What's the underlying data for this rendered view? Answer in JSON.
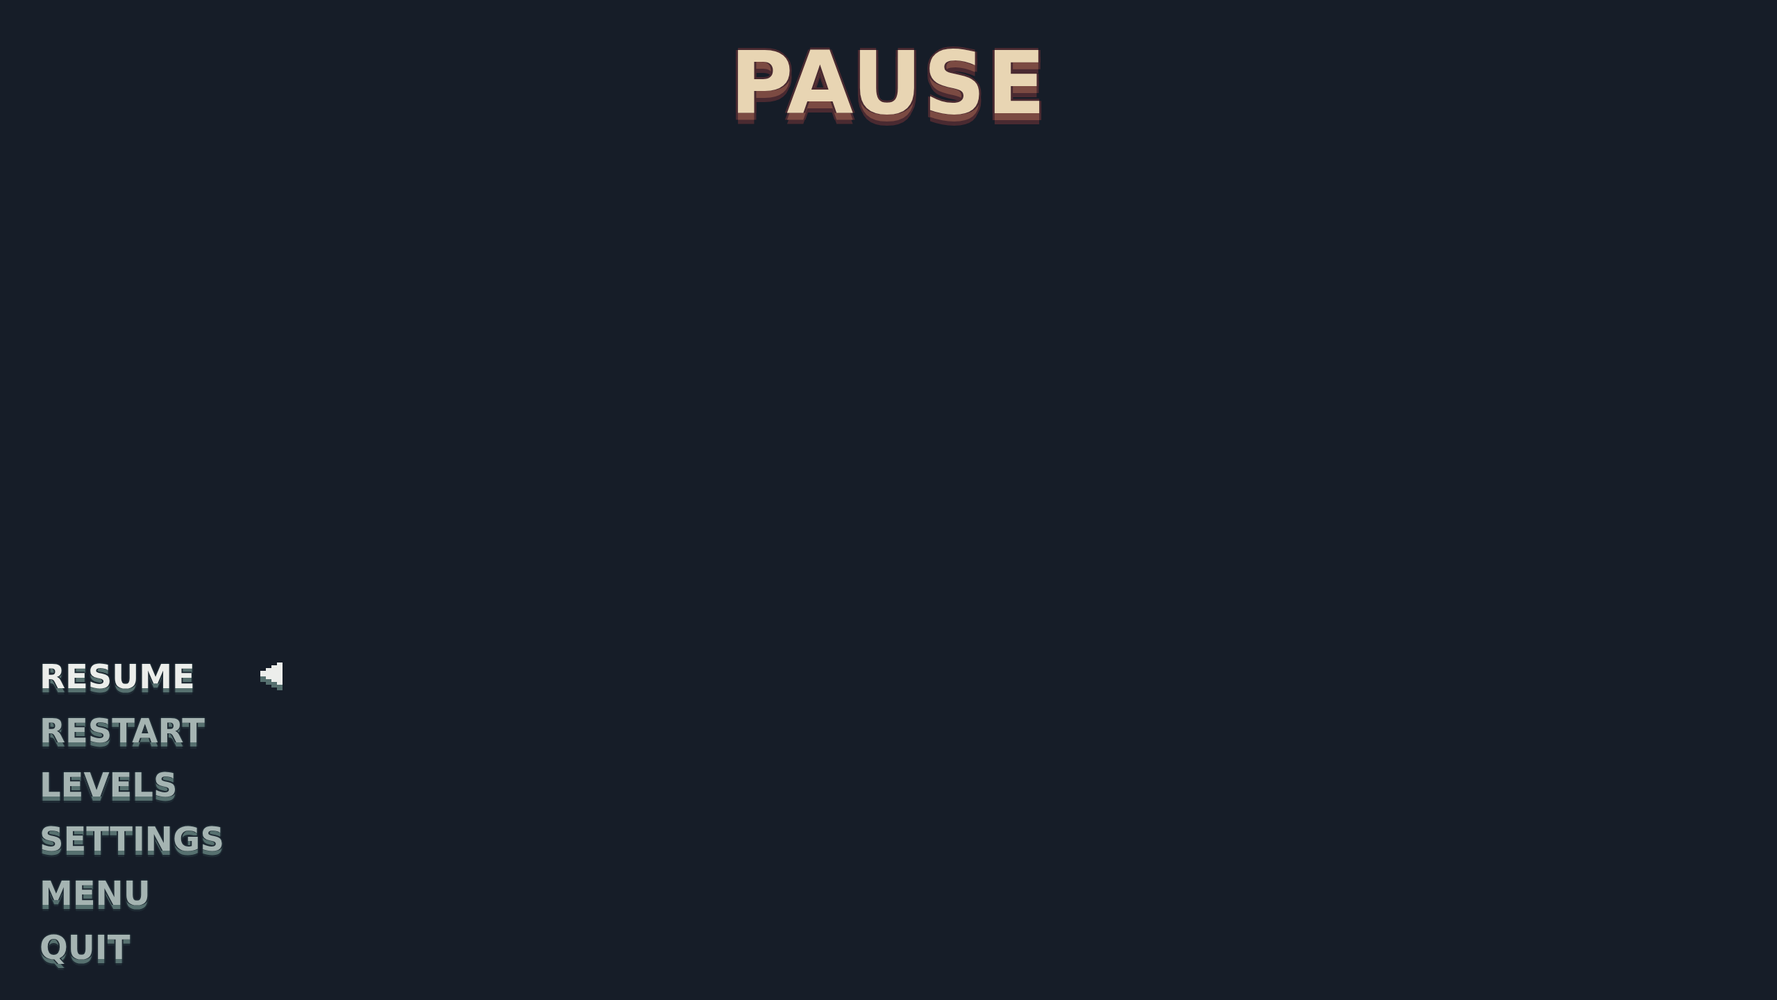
{
  "title": "PAUSE",
  "menu": [
    {
      "label": "RESUME",
      "selected": true
    },
    {
      "label": "RESTART",
      "selected": false
    },
    {
      "label": "LEVELS",
      "selected": false
    },
    {
      "label": "SETTINGS",
      "selected": false
    },
    {
      "label": "MENU",
      "selected": false
    },
    {
      "label": "QUIT",
      "selected": false
    }
  ]
}
